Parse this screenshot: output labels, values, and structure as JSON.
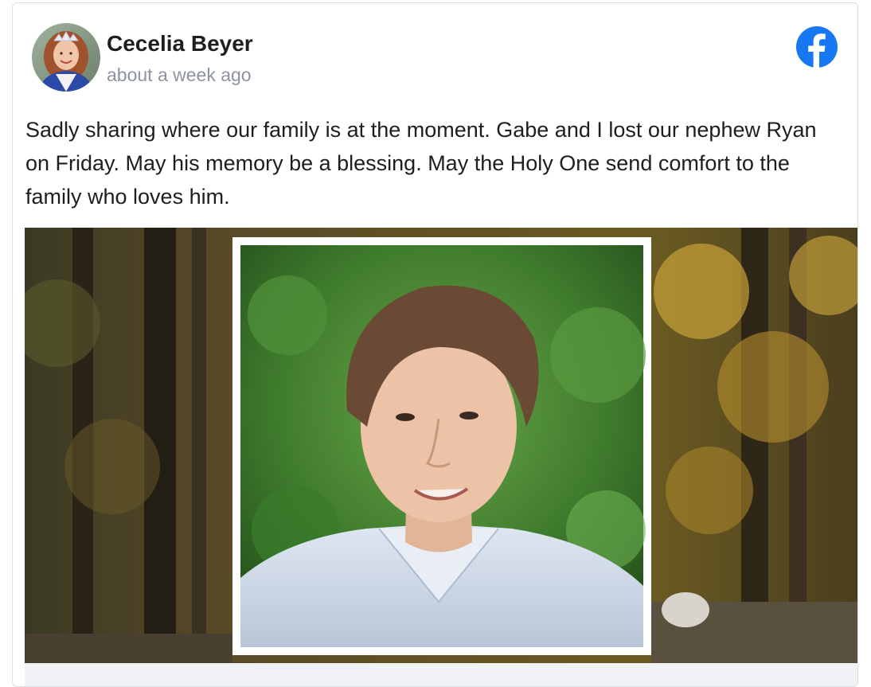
{
  "post": {
    "author_name": "Cecelia Beyer",
    "timestamp": "about a week ago",
    "text": "Sadly sharing where our family is at the moment. Gabe and I lost our nephew Ryan on Friday. May his memory be a blessing. May the Holy One send comfort to the family who loves him.",
    "source_icon": "facebook-logo-icon",
    "avatar_icon": "user-avatar-photo",
    "photo": "memorial-portrait-photo"
  },
  "colors": {
    "facebook_blue": "#1877f2",
    "name_text": "#1c1e21",
    "meta_text": "#8d949e",
    "card_border": "#dcdfe3"
  }
}
